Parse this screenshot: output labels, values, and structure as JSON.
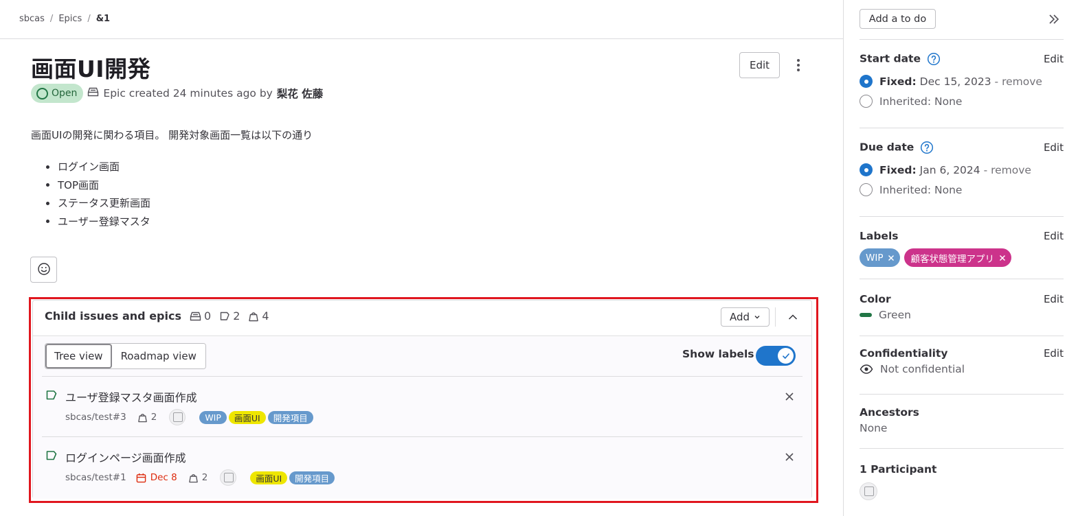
{
  "breadcrumb": {
    "group": "sbcas",
    "section": "Epics",
    "current": "&1"
  },
  "epic": {
    "title": "画面UI開発",
    "status": "Open",
    "created_text": "Epic created 24 minutes ago by",
    "author": "梨花 佐藤",
    "edit_label": "Edit",
    "description": "画面UIの開発に関わる項目。 開発対象画面一覧は以下の通り",
    "description_items": [
      "ログイン画面",
      "TOP画面",
      "ステータス更新画面",
      "ユーザー登録マスタ"
    ]
  },
  "child_section": {
    "title": "Child issues and epics",
    "counts": {
      "epics": "0",
      "issues": "2",
      "weight": "4"
    },
    "add_label": "Add",
    "views": [
      "Tree view",
      "Roadmap view"
    ],
    "active_view": "Tree view",
    "show_labels_label": "Show labels",
    "show_labels_on": true,
    "items": [
      {
        "title": "ユーザ登録マスタ画面作成",
        "ref": "sbcas/test#3",
        "due": "",
        "weight": "2",
        "labels": [
          {
            "text": "WIP",
            "bg": "#6699cc",
            "fg": "#ffffff"
          },
          {
            "text": "画面UI",
            "bg": "#eee600",
            "fg": "#333238"
          },
          {
            "text": "開発項目",
            "bg": "#6699cc",
            "fg": "#ffffff"
          }
        ]
      },
      {
        "title": "ログインページ画面作成",
        "ref": "sbcas/test#1",
        "due": "Dec 8",
        "weight": "2",
        "labels": [
          {
            "text": "画面UI",
            "bg": "#eee600",
            "fg": "#333238"
          },
          {
            "text": "開発項目",
            "bg": "#6699cc",
            "fg": "#ffffff"
          }
        ]
      }
    ]
  },
  "sidebar": {
    "todo_label": "Add a to do",
    "edit_label": "Edit",
    "start_date": {
      "title": "Start date",
      "fixed_label": "Fixed:",
      "fixed_value": "Dec 15, 2023",
      "remove": "- remove",
      "inherited": "Inherited: None"
    },
    "due_date": {
      "title": "Due date",
      "fixed_label": "Fixed:",
      "fixed_value": "Jan 6, 2024",
      "remove": "- remove",
      "inherited": "Inherited: None"
    },
    "labels": {
      "title": "Labels",
      "items": [
        {
          "text": "WIP",
          "bg": "#6699cc"
        },
        {
          "text": "顧客状態管理アプリ",
          "bg": "#cc338b"
        }
      ]
    },
    "color": {
      "title": "Color",
      "value": "Green",
      "swatch": "#217645"
    },
    "confidentiality": {
      "title": "Confidentiality",
      "value": "Not confidential"
    },
    "ancestors": {
      "title": "Ancestors",
      "value": "None"
    },
    "participants": {
      "title": "1 Participant"
    }
  },
  "colors": {
    "accent": "#1f75cb",
    "highlight_frame": "#e0161e",
    "issue_open": "#217645",
    "due_overdue": "#dd2b0e"
  }
}
